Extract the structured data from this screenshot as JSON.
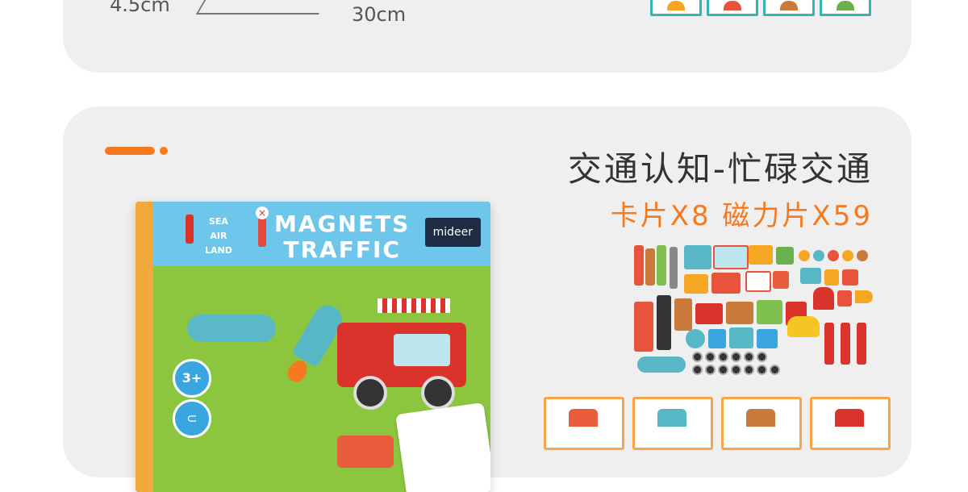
{
  "top_card": {
    "dim_left": "4.5cm",
    "dim_bottom": "30cm",
    "thumbnail_colors": [
      "#f5a623",
      "#e8533c",
      "#c97a3a",
      "#6ab04c"
    ]
  },
  "section": {
    "title": "交通认知-忙碌交通",
    "subtitle": "卡片X8  磁力片X59",
    "accent_color": "#f57a1f"
  },
  "product_box": {
    "sea_air_land": [
      "SEA",
      "AIR",
      "LAND"
    ],
    "title_line1": "MAGNETS",
    "title_line2": "TRAFFIC",
    "brand": "mideer",
    "age": "3+"
  },
  "card_thumbnail_colors": [
    "#e95d3c",
    "#58b7c5",
    "#c97a3a",
    "#d9332b"
  ]
}
